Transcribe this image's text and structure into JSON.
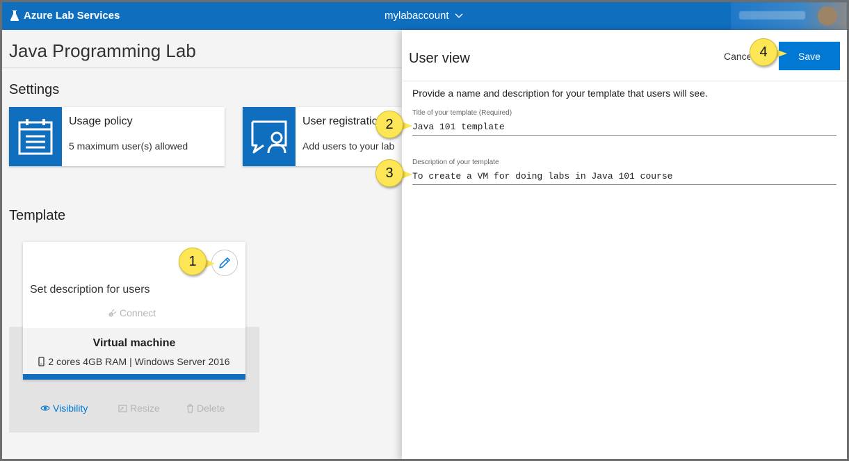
{
  "topbar": {
    "brand": "Azure Lab Services",
    "account": "mylabaccount"
  },
  "page": {
    "title": "Java Programming Lab",
    "settings_heading": "Settings",
    "template_heading": "Template"
  },
  "settings_cards": [
    {
      "title": "Usage policy",
      "subtitle": "5 maximum user(s) allowed",
      "icon": "calendar-icon"
    },
    {
      "title": "User registration",
      "subtitle": "Add users to your lab",
      "icon": "user-board-icon"
    }
  ],
  "template_card": {
    "description": "Set description for users",
    "connect_label": "Connect",
    "vm_title": "Virtual machine",
    "vm_spec": "2 cores 4GB RAM | Windows Server 2016",
    "actions": {
      "visibility": "Visibility",
      "resize": "Resize",
      "delete": "Delete"
    }
  },
  "panel": {
    "title": "User view",
    "cancel_label": "Cancel",
    "save_label": "Save",
    "intro": "Provide a name and description for your template that users will see.",
    "title_field": {
      "label": "Title of your template (Required)",
      "value": "Java 101 template"
    },
    "description_field": {
      "label": "Description of your template",
      "value": "To create a VM for doing labs in Java 101 course"
    }
  },
  "callouts": [
    "1",
    "2",
    "3",
    "4"
  ],
  "colors": {
    "brand_blue": "#106ebe",
    "save_blue": "#0078d4",
    "link_blue": "#0078d4",
    "callout_yellow": "#fce655",
    "disabled_gray": "#b5b5b5"
  }
}
